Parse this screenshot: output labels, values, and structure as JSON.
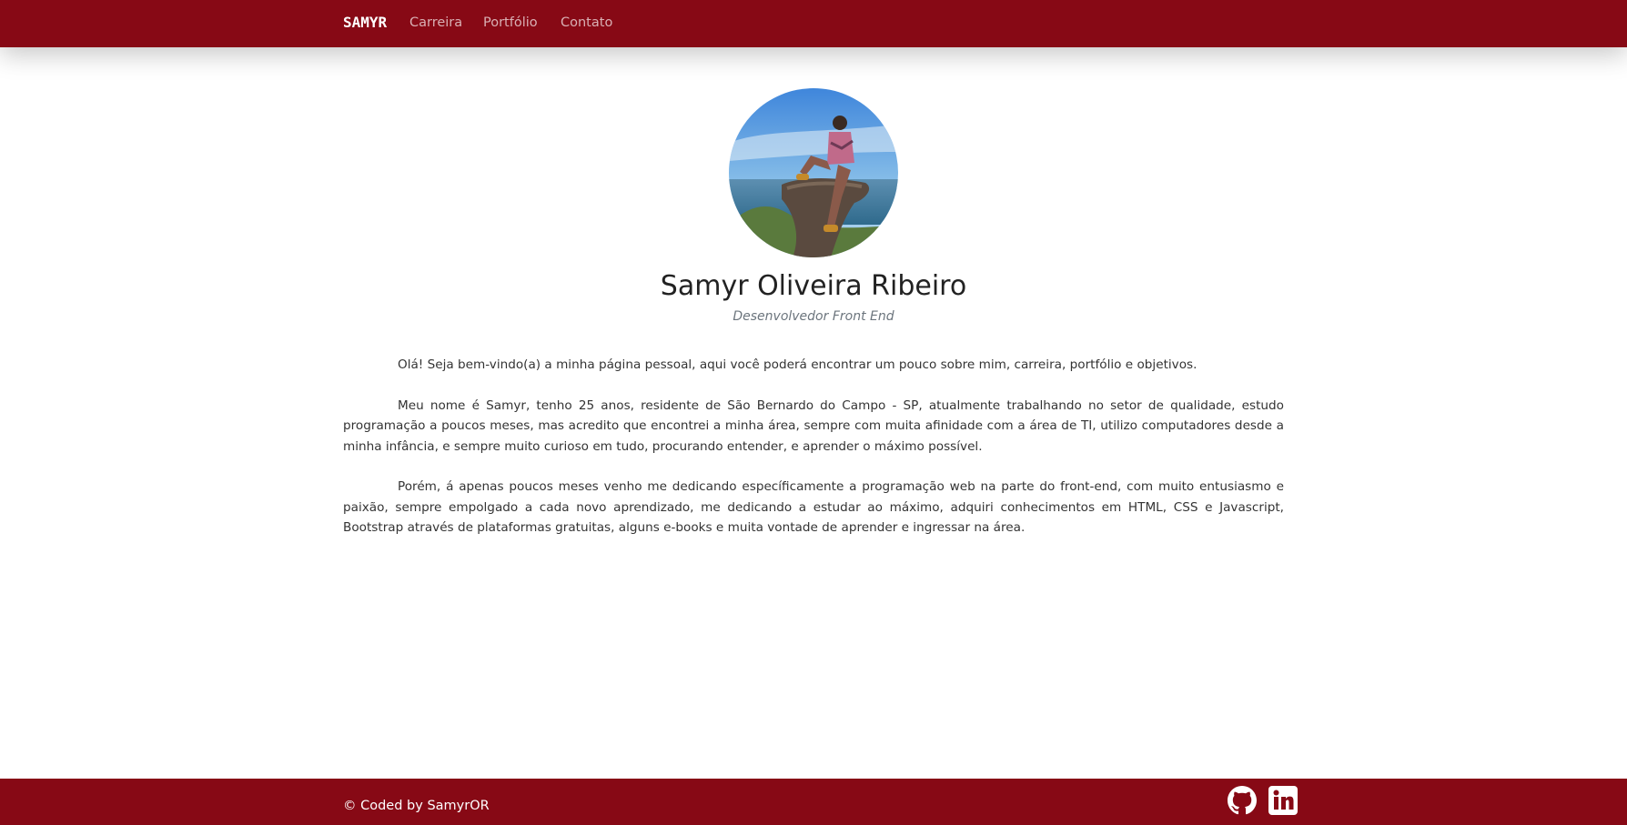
{
  "navbar": {
    "brand": "SAMYR",
    "links": [
      {
        "label": "Carreira"
      },
      {
        "label": "Portfólio"
      },
      {
        "label": "Contato"
      }
    ]
  },
  "profile": {
    "name": "Samyr Oliveira Ribeiro",
    "role": "Desenvolvedor Front End"
  },
  "about": {
    "paragraphs": [
      "Olá! Seja bem-vindo(a) a minha página pessoal, aqui você poderá encontrar um pouco sobre mim, carreira, portfólio e objetivos.",
      "Meu nome é Samyr, tenho 25 anos, residente de São Bernardo do Campo - SP, atualmente trabalhando no setor de qualidade, estudo programação a poucos meses, mas acredito que encontrei a minha área, sempre com muita afinidade com a área de TI, utilizo computadores desde a minha infância, e sempre muito curioso em tudo, procurando entender, e aprender o máximo possível.",
      "Porém, á apenas poucos meses venho me dedicando específicamente a programação web na parte do front-end, com muito entusiasmo e paixão, sempre empolgado a cada novo aprendizado, me dedicando a estudar ao máximo, adquiri conhecimentos em HTML, CSS e Javascript, Bootstrap através de plataformas gratuitas, alguns e-books e muita vontade de aprender e ingressar na área."
    ]
  },
  "footer": {
    "copyright": "© Coded by SamyrOR",
    "social": [
      {
        "icon": "github-icon"
      },
      {
        "icon": "linkedin-icon"
      }
    ]
  },
  "colors": {
    "brand": "#870915",
    "nav_link": "#d9b0b4",
    "text": "#333333",
    "muted": "#6c757d"
  }
}
